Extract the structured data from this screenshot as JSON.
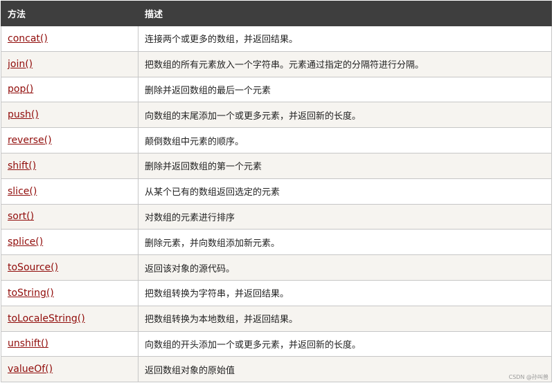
{
  "header": {
    "method": "方法",
    "description": "描述"
  },
  "rows": [
    {
      "method": "concat()",
      "description": "连接两个或更多的数组，并返回结果。"
    },
    {
      "method": "join()",
      "description": "把数组的所有元素放入一个字符串。元素通过指定的分隔符进行分隔。"
    },
    {
      "method": "pop()",
      "description": "删除并返回数组的最后一个元素"
    },
    {
      "method": "push()",
      "description": "向数组的末尾添加一个或更多元素，并返回新的长度。"
    },
    {
      "method": "reverse()",
      "description": "颠倒数组中元素的顺序。"
    },
    {
      "method": "shift()",
      "description": "删除并返回数组的第一个元素"
    },
    {
      "method": "slice()",
      "description": "从某个已有的数组返回选定的元素"
    },
    {
      "method": "sort()",
      "description": "对数组的元素进行排序"
    },
    {
      "method": "splice()",
      "description": "删除元素，并向数组添加新元素。"
    },
    {
      "method": "toSource()",
      "description": "返回该对象的源代码。"
    },
    {
      "method": "toString()",
      "description": "把数组转换为字符串，并返回结果。"
    },
    {
      "method": "toLocaleString()",
      "description": "把数组转换为本地数组，并返回结果。"
    },
    {
      "method": "unshift()",
      "description": "向数组的开头添加一个或更多元素，并返回新的长度。"
    },
    {
      "method": "valueOf()",
      "description": "返回数组对象的原始值"
    }
  ],
  "watermark": "CSDN @孙叫兽",
  "colors": {
    "header_bg": "#3e3e3e",
    "link": "#900b09",
    "stripe": "#f6f4f0",
    "border": "#c6c6c6"
  }
}
